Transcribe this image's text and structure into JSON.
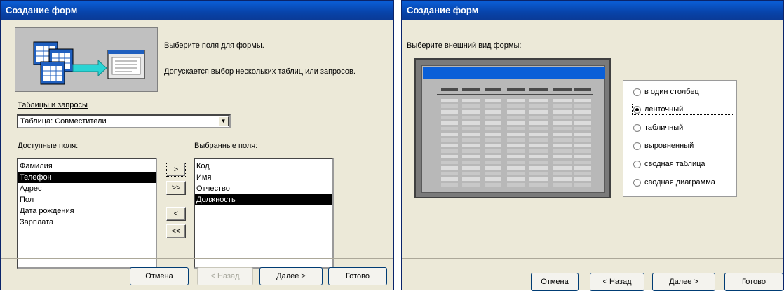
{
  "left_dialog": {
    "title": "Создание форм",
    "instruction": "Выберите поля для формы.",
    "note": "Допускается выбор нескольких таблиц или запросов.",
    "tables_label": "Таблицы и запросы",
    "table_value": "Таблица: Совместители",
    "available_label": "Доступные поля:",
    "selected_label": "Выбранные поля:",
    "available_fields": [
      "Фамилия",
      "Телефон",
      "Адрес",
      "Пол",
      "Дата рождения",
      "Зарплата"
    ],
    "available_selected_index": 1,
    "selected_fields": [
      "Код",
      "Имя",
      "Отчество",
      "Должность"
    ],
    "selected_selected_index": 3,
    "move_buttons": [
      ">",
      ">>",
      "<",
      "<<"
    ],
    "buttons": {
      "cancel": "Отмена",
      "back": "< Назад",
      "next": "Далее >",
      "finish": "Готово"
    }
  },
  "right_dialog": {
    "title": "Создание форм",
    "instruction": "Выберите внешний вид формы:",
    "layout_options": [
      "в один столбец",
      "ленточный",
      "табличный",
      "выровненный",
      "сводная таблица",
      "сводная диаграмма"
    ],
    "selected_option_index": 1,
    "buttons": {
      "cancel": "Отмена",
      "back": "< Назад",
      "next": "Далее >",
      "finish": "Готово"
    }
  }
}
